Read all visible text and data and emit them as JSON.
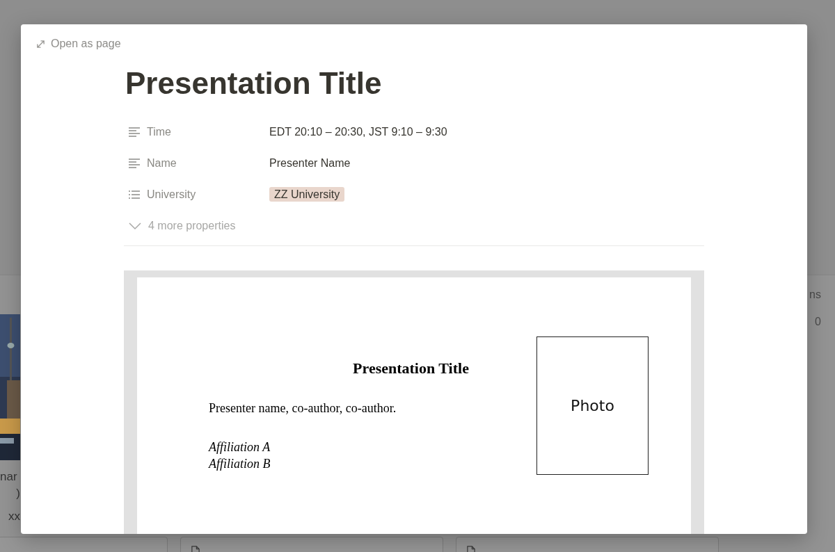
{
  "background": {
    "left_card": {
      "kind": "picture",
      "lines": [
        "nar",
        ")",
        "xx"
      ]
    },
    "right_column": {
      "header": "ns",
      "value": "0"
    },
    "bottom_cards": [
      {
        "kind": "plain"
      },
      {
        "kind": "page"
      },
      {
        "kind": "page"
      }
    ]
  },
  "modal": {
    "open_as_page": "Open as page",
    "title": "Presentation Title",
    "properties": [
      {
        "kind": "text",
        "label": "Time",
        "value": "EDT 20:10 – 20:30, JST 9:10 – 9:30"
      },
      {
        "kind": "text",
        "label": "Name",
        "value": "Presenter Name"
      },
      {
        "kind": "select",
        "label": "University",
        "value": "ZZ University"
      }
    ],
    "more_properties": "4 more properties",
    "slide": {
      "title": "Presentation Title",
      "authors": "Presenter name, co-author, co-author.",
      "affiliations": [
        "Affiliation A",
        "Affiliation B"
      ],
      "photo_label": "Photo"
    }
  }
}
